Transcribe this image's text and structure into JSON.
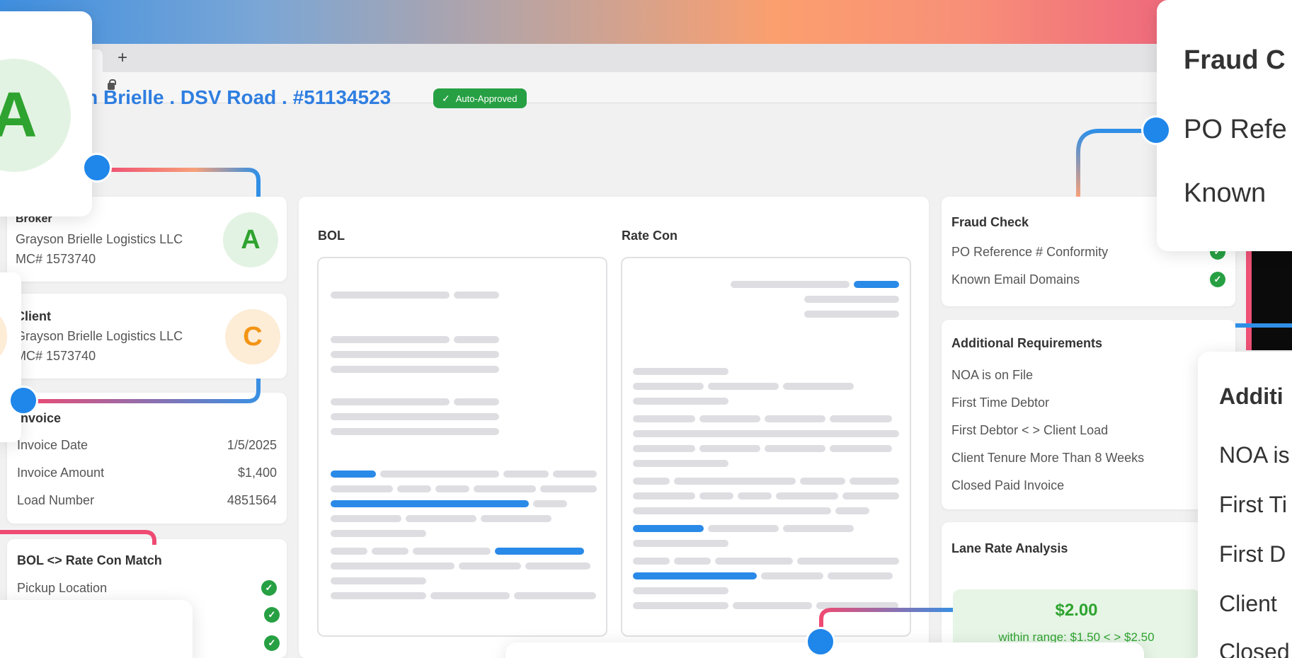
{
  "page": {
    "title": "on Brielle . DSV Road . #51134523",
    "badge": "Auto-Approved",
    "new_tab": "+"
  },
  "broker": {
    "heading": "Broker",
    "company": "Grayson Brielle Logistics LLC",
    "mc": "MC# 1573740",
    "avatar_letter": "A"
  },
  "client": {
    "heading": "Client",
    "company": "Grayson Brielle Logistics LLC",
    "mc": "MC# 1573740",
    "avatar_letter": "C"
  },
  "invoice": {
    "heading": "Invoice",
    "rows": [
      {
        "label": "Invoice Date",
        "value": "1/5/2025"
      },
      {
        "label": "Invoice Amount",
        "value": "$1,400"
      },
      {
        "label": "Load Number",
        "value": "4851564"
      }
    ]
  },
  "match": {
    "heading": "BOL <> Rate Con Match",
    "rows": [
      {
        "label": "Pickup Location"
      }
    ]
  },
  "documents": {
    "bol_label": "BOL",
    "ratecon_label": "Rate Con"
  },
  "fraud": {
    "heading": "Fraud Check",
    "rows": [
      {
        "label": "PO Reference # Conformity"
      },
      {
        "label": "Known Email Domains"
      }
    ]
  },
  "requirements": {
    "heading": "Additional Requirements",
    "rows": [
      {
        "label": "NOA is on File"
      },
      {
        "label": "First Time Debtor"
      },
      {
        "label": "First Debtor < > Client Load"
      },
      {
        "label": "Client Tenure More Than 8 Weeks"
      },
      {
        "label": "Closed Paid Invoice"
      }
    ]
  },
  "lane": {
    "heading": "Lane Rate Analysis",
    "value": "$2.00",
    "range": "within range: $1.50 < > $2.50"
  },
  "zoom_fraud": {
    "heading": "Fraud C",
    "rows": [
      "PO Refe",
      "Known"
    ]
  },
  "zoom_requirements": {
    "heading": "Additi",
    "rows": [
      "NOA is",
      "First Ti",
      "First D",
      "Client",
      "Closed"
    ]
  },
  "zoom_broker": {
    "avatar_letter": "A"
  },
  "colors": {
    "accent_blue": "#2a8ae8",
    "success_green": "#27a043",
    "orange": "#f39414",
    "pink": "#ee5277"
  }
}
